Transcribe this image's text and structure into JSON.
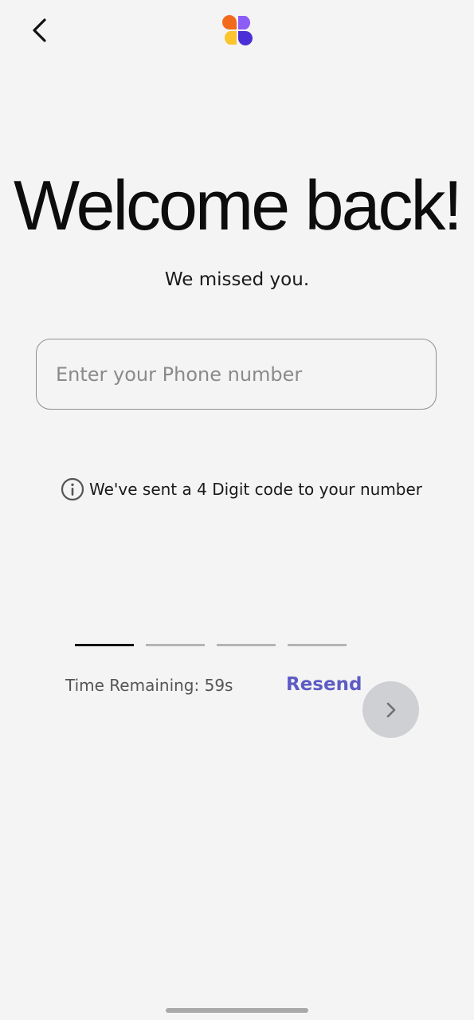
{
  "header": {
    "back_icon": "chevron-left-icon",
    "logo_icon": "four-petal-logo",
    "logo_colors": [
      "#f26a1b",
      "#8b5cf6",
      "#fbc52d",
      "#4a2fd6"
    ]
  },
  "main": {
    "title": "Welcome back!",
    "subtitle": "We missed you.",
    "phone_placeholder": "Enter your Phone number",
    "phone_value": "",
    "info_icon": "info-circle-icon",
    "info_text": "We've sent a 4 Digit code to your number",
    "otp_slots": 4,
    "otp_active_index": 0,
    "timer_text": "Time Remaining: 59s",
    "resend_label": "Resend",
    "next_icon": "chevron-right-icon"
  },
  "colors": {
    "background": "#f4f4f4",
    "accent": "#5e5cc4",
    "next_button_disabled": "#cfd0d3"
  }
}
